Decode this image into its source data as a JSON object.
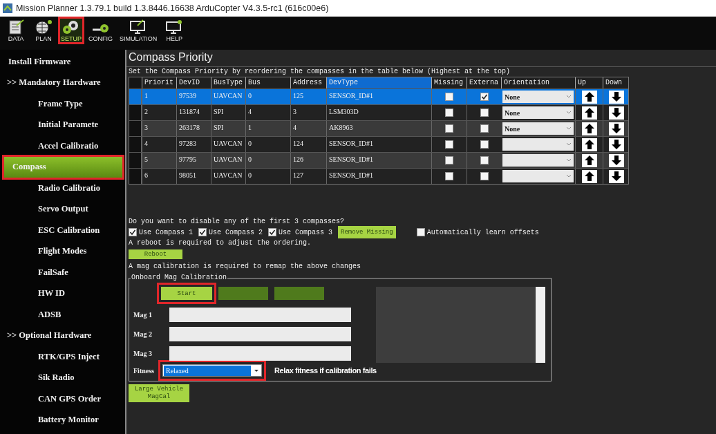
{
  "window": {
    "title": "Mission Planner 1.3.79.1 build 1.3.8446.16638 ArduCopter V4.3.5-rc1 (616c00e6)"
  },
  "toolbar": [
    {
      "kind": "data",
      "label": "DATA",
      "selected": false,
      "highlighted": false
    },
    {
      "kind": "plan",
      "label": "PLAN",
      "selected": false,
      "highlighted": false
    },
    {
      "kind": "setup",
      "label": "SETUP",
      "selected": true,
      "highlighted": true
    },
    {
      "kind": "config",
      "label": "CONFIG",
      "selected": false,
      "highlighted": false
    },
    {
      "kind": "simulation",
      "label": "SIMULATION",
      "selected": false,
      "highlighted": false
    },
    {
      "kind": "help",
      "label": "HELP",
      "selected": false,
      "highlighted": false
    }
  ],
  "sidebar": {
    "items": [
      {
        "kind": "top",
        "label": "Install Firmware",
        "selected": false,
        "highlighted": false
      },
      {
        "kind": "group",
        "label": ">> Mandatory Hardware",
        "selected": false,
        "highlighted": false
      },
      {
        "kind": "item",
        "label": "Frame Type",
        "selected": false,
        "highlighted": false
      },
      {
        "kind": "item",
        "label": "Initial Paramete",
        "selected": false,
        "highlighted": false
      },
      {
        "kind": "item",
        "label": "Accel Calibratio",
        "selected": false,
        "highlighted": false
      },
      {
        "kind": "item",
        "label": "Compass",
        "selected": true,
        "highlighted": true
      },
      {
        "kind": "item",
        "label": "Radio Calibratio",
        "selected": false,
        "highlighted": false
      },
      {
        "kind": "item",
        "label": "Servo Output",
        "selected": false,
        "highlighted": false
      },
      {
        "kind": "item",
        "label": "ESC Calibration",
        "selected": false,
        "highlighted": false
      },
      {
        "kind": "item",
        "label": "Flight Modes",
        "selected": false,
        "highlighted": false
      },
      {
        "kind": "item",
        "label": "FailSafe",
        "selected": false,
        "highlighted": false
      },
      {
        "kind": "item",
        "label": "HW ID",
        "selected": false,
        "highlighted": false
      },
      {
        "kind": "item",
        "label": "ADSB",
        "selected": false,
        "highlighted": false
      },
      {
        "kind": "group",
        "label": ">> Optional Hardware",
        "selected": false,
        "highlighted": false
      },
      {
        "kind": "item",
        "label": "RTK/GPS Inject",
        "selected": false,
        "highlighted": false
      },
      {
        "kind": "item",
        "label": "Sik Radio",
        "selected": false,
        "highlighted": false
      },
      {
        "kind": "item",
        "label": "CAN GPS Order",
        "selected": false,
        "highlighted": false
      },
      {
        "kind": "item",
        "label": "Battery Monitor",
        "selected": false,
        "highlighted": false
      }
    ]
  },
  "page_title": "Compass Priority",
  "table": {
    "description": "Set the Compass Priority by reordering the compasses in the table below (Highest at the top)",
    "columns": [
      {
        "label": "Priorit",
        "sorted": false
      },
      {
        "label": "DevID",
        "sorted": false
      },
      {
        "label": "BusType",
        "sorted": false
      },
      {
        "label": "Bus",
        "sorted": false
      },
      {
        "label": "Address",
        "sorted": false
      },
      {
        "label": "DevType",
        "sorted": true
      },
      {
        "label": "Missing",
        "sorted": false
      },
      {
        "label": "Externa",
        "sorted": false
      },
      {
        "label": "Orientation",
        "sorted": false
      },
      {
        "label": "Up",
        "sorted": false
      },
      {
        "label": "Down",
        "sorted": false
      }
    ],
    "rows": [
      {
        "priority": "1",
        "dev_id": "97539",
        "bus_type": "UAVCAN",
        "bus": "0",
        "address": "125",
        "dev_type": "SENSOR_ID#1",
        "missing": false,
        "external": true,
        "orientation": "None",
        "selected": true
      },
      {
        "priority": "2",
        "dev_id": "131874",
        "bus_type": "SPI",
        "bus": "4",
        "address": "3",
        "dev_type": "LSM303D",
        "missing": false,
        "external": false,
        "orientation": "None",
        "selected": false
      },
      {
        "priority": "3",
        "dev_id": "263178",
        "bus_type": "SPI",
        "bus": "1",
        "address": "4",
        "dev_type": "AK8963",
        "missing": false,
        "external": false,
        "orientation": "None",
        "selected": false
      },
      {
        "priority": "4",
        "dev_id": "97283",
        "bus_type": "UAVCAN",
        "bus": "0",
        "address": "124",
        "dev_type": "SENSOR_ID#1",
        "missing": false,
        "external": false,
        "selected": false
      },
      {
        "priority": "5",
        "dev_id": "97795",
        "bus_type": "UAVCAN",
        "bus": "0",
        "address": "126",
        "dev_type": "SENSOR_ID#1",
        "missing": false,
        "external": false,
        "selected": false
      },
      {
        "priority": "6",
        "dev_id": "98051",
        "bus_type": "UAVCAN",
        "bus": "0",
        "address": "127",
        "dev_type": "SENSOR_ID#1",
        "missing": false,
        "external": false,
        "selected": false
      }
    ]
  },
  "disable_question": "Do you want to disable any of the first 3 compasses?",
  "use_compass": [
    {
      "label": "Use Compass 1",
      "checked": true
    },
    {
      "label": "Use Compass 2",
      "checked": true
    },
    {
      "label": "Use Compass 3",
      "checked": true
    }
  ],
  "remove_missing_button": "Remove Missing",
  "auto_learn": {
    "label": "Automatically learn offsets",
    "checked": false
  },
  "reboot_note": "A reboot is required to adjust the ordering.",
  "reboot_button": "Reboot",
  "magcal_note": "A mag calibration is required to remap the above changes",
  "onboard_calibration": {
    "title": "Onboard Mag Calibration",
    "buttons": [
      {
        "label": "Start",
        "disabled": false,
        "highlighted": true
      },
      {
        "disabled": true
      },
      {
        "disabled": true
      }
    ],
    "mags": [
      {
        "label": "Mag 1",
        "level": 0
      },
      {
        "label": "Mag 2",
        "level": 0
      },
      {
        "label": "Mag 3",
        "level": 0
      }
    ],
    "fitness": {
      "label": "Fitness",
      "value": "Relaxed",
      "highlighted": true
    },
    "fitness_hint": "Relax fitness if calibration fails"
  },
  "large_vehicle_button": "Large Vehicle MagCal"
}
